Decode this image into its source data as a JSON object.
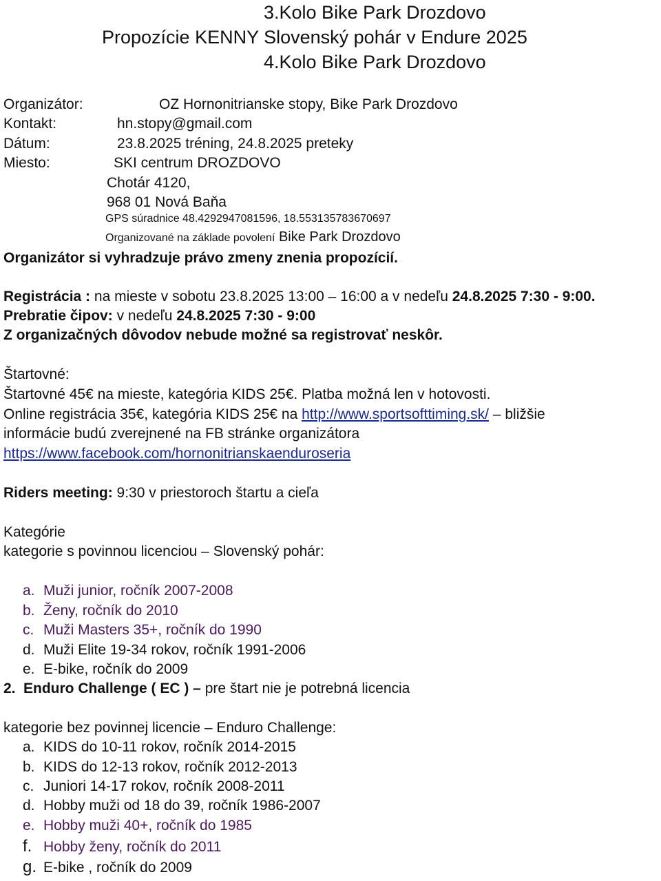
{
  "titles": {
    "line1": "3.Kolo Bike Park Drozdovo",
    "line2": "Propozície KENNY Slovenský pohár v Endure 2025",
    "line3": "4.Kolo Bike Park Drozdovo"
  },
  "info": {
    "organizer_label": "Organizátor:",
    "organizer_value": "OZ Hornonitrianske stopy, Bike Park Drozdovo",
    "contact_label": "Kontakt:",
    "contact_value": "hn.stopy@gmail.com",
    "date_label": "Dátum:",
    "date_value": "23.8.2025 tréning, 24.8.2025 preteky",
    "place_label": "Miesto:",
    "place_line1": "SKI centrum DROZDOVO",
    "place_line2": "Chotár 4120,",
    "place_line3": "968 01 Nová Baňa",
    "gps": "GPS súradnice 48.4292947081596, 18.553135783670697",
    "permit_prefix": "Organizované na základe povolení",
    "permit_suffix": " Bike Park Drozdovo",
    "reserve_note": "Organizátor si vyhradzuje právo zmeny znenia propozícií."
  },
  "registration": {
    "label": "Registrácia :",
    "text": " na mieste  v sobotu 23.8.2025 13:00 – 16:00 a v nedeľu ",
    "date_bold": "24.8.2025  7:30 - 9:00.",
    "chips_label": "Prebratie čipov:",
    "chips_text": " v nedeľu ",
    "chips_bold": "24.8.2025  7:30 - 9:00",
    "late_note": "Z organizačných dôvodov nebude možné sa registrovať neskôr."
  },
  "fee": {
    "heading": "Štartovné:",
    "line1": "Štartovné 45€ na mieste, kategória KIDS 25€. Platba možná len v hotovosti.",
    "line2_prefix": "Online registrácia 35€, kategória KIDS 25€ na ",
    "line2_link": "http://www.sportsofttiming.sk/",
    "line2_suffix": " – bližšie",
    "line3": "informácie budú zverejnené na FB stránke organizátora",
    "fb_link": "https://www.facebook.com/hornonitrianskaenduroseria"
  },
  "meeting": {
    "label": "Riders meeting:",
    "text": " 9:30 v priestoroch štartu a cieľa"
  },
  "categories": {
    "heading": "Kategórie",
    "licensed_intro": "kategorie s povinnou licenciou – Slovenský pohár:",
    "licensed": [
      {
        "marker": "a.",
        "text": "Muži junior, ročník 2007-2008"
      },
      {
        "marker": "b.",
        "text": "Ženy, ročník do 2010"
      },
      {
        "marker": "c.",
        "text": "Muži Masters 35+, ročník do 1990"
      },
      {
        "marker": "d.",
        "text": "Muži Elite 19-34 rokov, ročník  1991-2006"
      },
      {
        "marker": "e.",
        "text": "E-bike, ročník do 2009"
      }
    ],
    "challenge_marker": "2.",
    "challenge_bold": "Enduro Challenge ( EC ) –",
    "challenge_text": " pre štart nie je potrebná licencia",
    "unlicensed_intro": "kategorie bez povinnej licencie – Enduro Challenge:",
    "unlicensed": [
      {
        "marker": "a.",
        "text": "KIDS do 10-11 rokov, ročník  2014-2015"
      },
      {
        "marker": "b.",
        "text": "KIDS do 12-13 rokov, ročník 2012-2013"
      },
      {
        "marker": "c.",
        "text": "Juniori 14-17 rokov, ročník 2008-2011"
      },
      {
        "marker": "d.",
        "text": "Hobby muži od 18 do 39, ročník 1986-2007"
      },
      {
        "marker": "e.",
        "text": "Hobby muži 40+, ročník do 1985"
      },
      {
        "marker": "f.",
        "text": "Hobby ženy,  ročník do 2011"
      },
      {
        "marker": "g.",
        "text": "E-bike , ročník do 2009"
      }
    ]
  }
}
